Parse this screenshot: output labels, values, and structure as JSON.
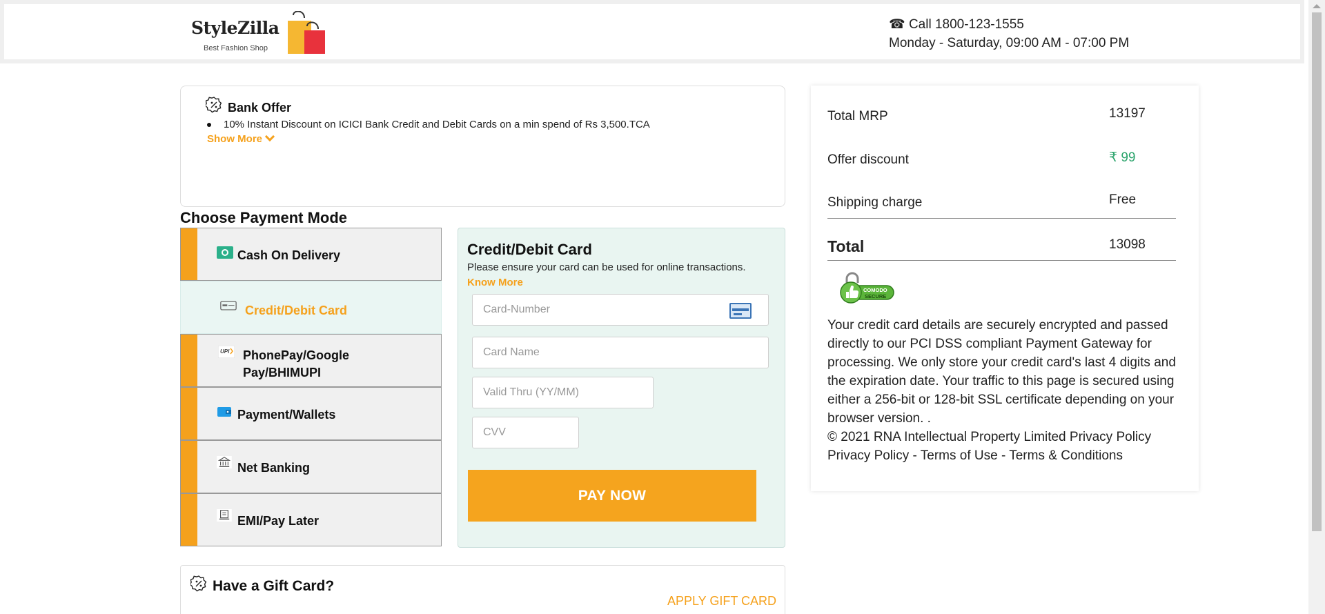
{
  "header": {
    "logo_name": "StyleZilla",
    "logo_tagline": "Best Fashion Shop",
    "phone": "Call 1800-123-1555",
    "hours": "Monday - Saturday, 09:00 AM - 07:00 PM"
  },
  "offer": {
    "title": "Bank Offer",
    "line": "10% Instant Discount on ICICI Bank Credit and Debit Cards on a min spend of Rs 3,500.TCA",
    "show_more": "Show More"
  },
  "payment": {
    "title": "Choose Payment Mode",
    "modes": [
      {
        "label": "Cash On Delivery",
        "icon": "cash-icon",
        "active": false
      },
      {
        "label": "Credit/Debit Card",
        "icon": "card-icon",
        "active": true
      },
      {
        "label": "PhonePay/Google Pay/BHIMUPI",
        "icon": "upi-icon",
        "active": false
      },
      {
        "label": "Payment/Wallets",
        "icon": "wallet-icon",
        "active": false
      },
      {
        "label": "Net Banking",
        "icon": "bank-icon",
        "active": false
      },
      {
        "label": "EMI/Pay Later",
        "icon": "emi-icon",
        "active": false
      }
    ]
  },
  "card_form": {
    "title": "Credit/Debit Card",
    "note": "Please ensure your card can be used for online transactions.",
    "know_more": "Know More",
    "number_placeholder": "Card-Number",
    "name_placeholder": "Card Name",
    "valid_placeholder": "Valid Thru (YY/MM)",
    "cvv_placeholder": "CVV",
    "pay_button": "PAY NOW"
  },
  "gift": {
    "title": "Have a Gift Card?",
    "apply": "APPLY GIFT CARD"
  },
  "summary": {
    "total_mrp_label": "Total MRP",
    "total_mrp_value": "13197",
    "offer_discount_label": "Offer discount",
    "offer_discount_value": "₹ 99",
    "shipping_label": "Shipping charge",
    "shipping_value": "Free",
    "total_label": "Total",
    "total_value": "13098",
    "badge_text_1": "COMODO",
    "badge_text_2": "SECURE",
    "secure_text": "Your credit card details are securely encrypted and passed directly to our PCI DSS compliant Payment Gateway for processing. We only store your credit card's last 4 digits and the expiration date. Your traffic to this page is secured using either a 256-bit or 128-bit SSL certificate depending on your browser version. .",
    "copyright_line": "© 2021 RNA Intellectual Property Limited Privacy Policy",
    "links_line": "Privacy Policy - Terms of Use - Terms & Conditions"
  },
  "colors": {
    "accent": "#f5a11c",
    "panel_bg": "#e9f5f1",
    "discount_green": "#2aa36b"
  }
}
